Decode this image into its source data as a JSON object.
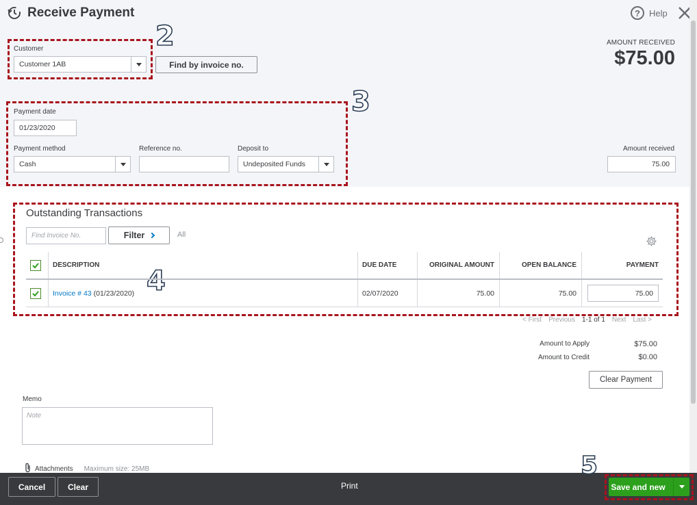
{
  "header": {
    "title": "Receive Payment",
    "help_label": "Help",
    "amount_received_label": "AMOUNT RECEIVED",
    "amount_received_value": "$75.00"
  },
  "customer": {
    "label": "Customer",
    "value": "Customer 1AB",
    "find_button": "Find by invoice no."
  },
  "payment": {
    "date_label": "Payment date",
    "date_value": "01/23/2020",
    "method_label": "Payment method",
    "method_value": "Cash",
    "reference_label": "Reference no.",
    "reference_value": "",
    "deposit_label": "Deposit to",
    "deposit_value": "Undeposited Funds",
    "amount_label": "Amount received",
    "amount_value": "75.00"
  },
  "annotations": {
    "step2": "2",
    "step3": "3",
    "step4": "4",
    "step5": "5"
  },
  "outstanding": {
    "title": "Outstanding Transactions",
    "search_placeholder": "Find Invoice No.",
    "filter_label": "Filter",
    "all_label": "All",
    "columns": {
      "description": "DESCRIPTION",
      "due_date": "DUE DATE",
      "original_amount": "ORIGINAL AMOUNT",
      "open_balance": "OPEN BALANCE",
      "payment": "PAYMENT"
    },
    "rows": [
      {
        "invoice_link": "Invoice # 43",
        "invoice_date": "(01/23/2020)",
        "due_date": "02/07/2020",
        "original_amount": "75.00",
        "open_balance": "75.00",
        "payment": "75.00"
      }
    ],
    "pager": {
      "first": "< First",
      "previous": "Previous",
      "range": "1-1 of 1",
      "next": "Next",
      "last": "Last >"
    }
  },
  "totals": {
    "apply_label": "Amount to Apply",
    "apply_value": "$75.00",
    "credit_label": "Amount to Credit",
    "credit_value": "$0.00",
    "clear_payment": "Clear Payment"
  },
  "memo": {
    "label": "Memo",
    "placeholder": "Note"
  },
  "attachments": {
    "label": "Attachments",
    "max_size": "Maximum size: 25MB"
  },
  "footer": {
    "cancel": "Cancel",
    "clear": "Clear",
    "print": "Print",
    "save": "Save and new"
  },
  "colors": {
    "accent_green": "#2ca01c",
    "annotation_red": "#a8141d",
    "link_blue": "#0077c5",
    "footer_bg": "#393a3d"
  }
}
